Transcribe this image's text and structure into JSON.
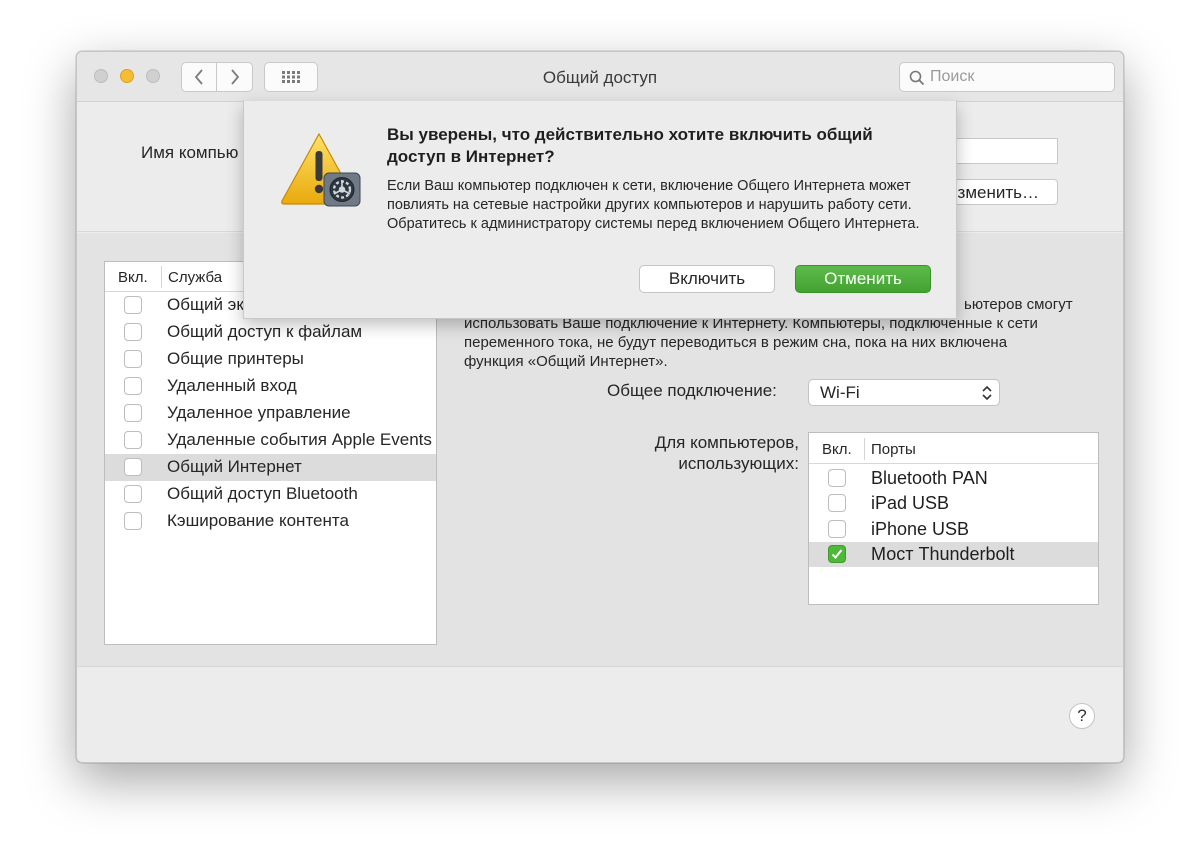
{
  "window": {
    "title": "Общий доступ",
    "search_placeholder": "Поиск"
  },
  "top": {
    "computer_name_label": "Имя компью",
    "edit_button_label": "зменить…"
  },
  "services": {
    "header_on": "Вкл.",
    "header_service": "Служба",
    "items": [
      {
        "label": "Общий эк",
        "checked": false,
        "selected": false
      },
      {
        "label": "Общий доступ к файлам",
        "checked": false,
        "selected": false
      },
      {
        "label": "Общие принтеры",
        "checked": false,
        "selected": false
      },
      {
        "label": "Удаленный вход",
        "checked": false,
        "selected": false
      },
      {
        "label": "Удаленное управление",
        "checked": false,
        "selected": false
      },
      {
        "label": "Удаленные события Apple Events",
        "checked": false,
        "selected": false
      },
      {
        "label": "Общий Интернет",
        "checked": false,
        "selected": true
      },
      {
        "label": "Общий доступ Bluetooth",
        "checked": false,
        "selected": false
      },
      {
        "label": "Кэширование контента",
        "checked": false,
        "selected": false
      }
    ]
  },
  "detail": {
    "description_lines": [
      "ьютеров смогут",
      "использовать Ваше подключение к Интернету. Компьютеры, подключенные к сети",
      "переменного тока, не будут переводиться в режим сна, пока на них включена",
      "функция «Общий Интернет»."
    ],
    "connection_label": "Общее подключение:",
    "connection_value": "Wi-Fi",
    "for_computers_label_line1": "Для компьютеров,",
    "for_computers_label_line2": "использующих:",
    "ports_header_on": "Вкл.",
    "ports_header_ports": "Порты",
    "ports": [
      {
        "label": "Bluetooth PAN",
        "checked": false,
        "selected": false
      },
      {
        "label": "iPad USB",
        "checked": false,
        "selected": false
      },
      {
        "label": "iPhone USB",
        "checked": false,
        "selected": false
      },
      {
        "label": "Мост Thunderbolt",
        "checked": true,
        "selected": true
      }
    ]
  },
  "help": {
    "label": "?"
  },
  "alert": {
    "title": "Вы уверены, что действительно хотите включить общий доступ в Интернет?",
    "message": "Если Ваш компьютер подключен к сети, включение Общего Интернета может повлиять на сетевые настройки других компьютеров и нарушить работу сети. Обратитесь к администратору системы перед включением Общего Интернета.",
    "enable_label": "Включить",
    "cancel_label": "Отменить",
    "icon": "warning-icon"
  },
  "colors": {
    "accent_green": "#4eb83b",
    "warning_yellow": "#f5c518"
  }
}
